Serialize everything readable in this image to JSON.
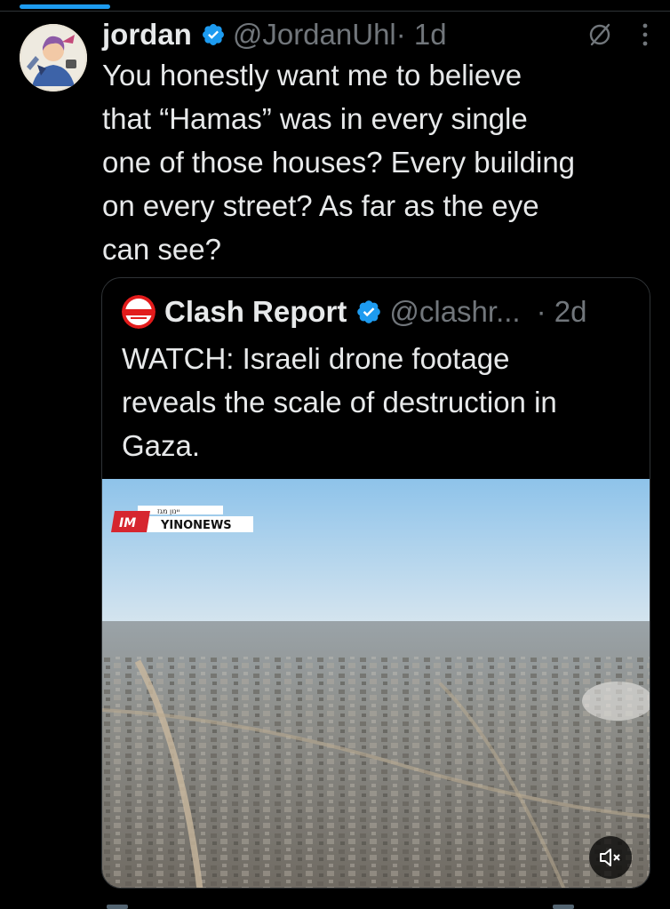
{
  "tweet": {
    "display_name": "jordan",
    "handle": "@JordanUhl",
    "time": " · 1d",
    "text": "You honestly want me to believe\nthat “Hamas” was in every single\none of those houses? Every building\non every street? As far as the eye\ncan see?",
    "icons": {
      "verified": "verified-badge-icon",
      "grok": "grok-icon",
      "more": "more-vertical-icon"
    }
  },
  "quote": {
    "display_name": "Clash Report",
    "handle": "@clashr...",
    "time": "· 2d",
    "text": "WATCH: Israeli drone footage\nreveals the scale of destruction in\nGaza.",
    "media": {
      "logo_text": "YINONEWS",
      "logo_small_text": "יינון מגז",
      "logo_mark": "IM",
      "mute_icon": "volume-muted-icon"
    }
  },
  "colors": {
    "accent": "#1d9bf0",
    "background": "#000000",
    "muted_text": "#71767b",
    "border": "#2f3336"
  }
}
